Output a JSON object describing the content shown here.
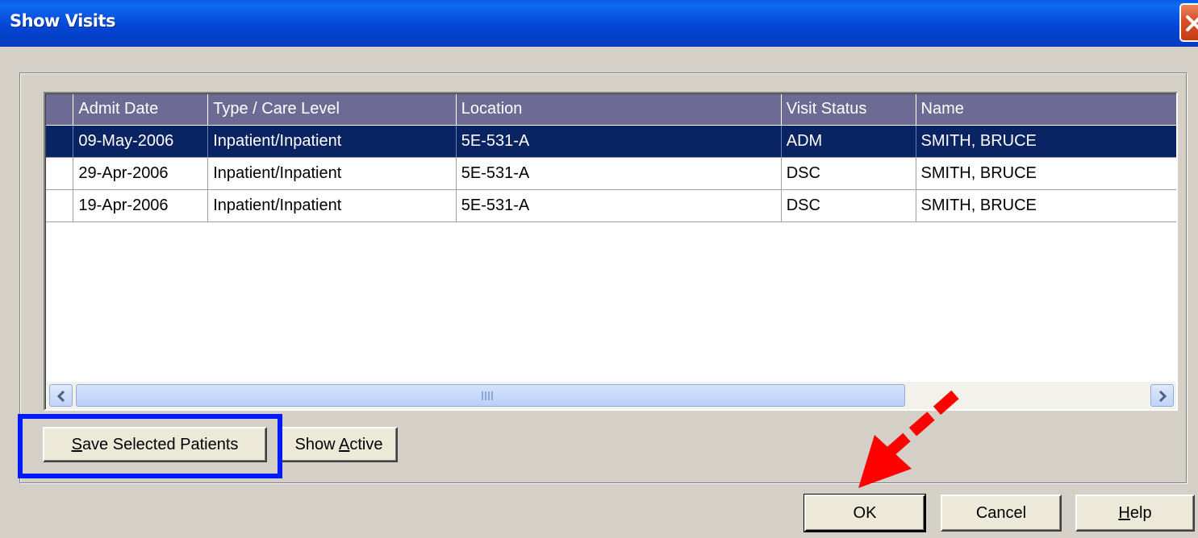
{
  "window": {
    "title": "Show Visits"
  },
  "grid": {
    "columns": [
      "Admit Date",
      "Type / Care Level",
      "Location",
      "Visit Status",
      "Name"
    ],
    "rows": [
      {
        "admit_date": "09-May-2006",
        "type": "Inpatient/Inpatient",
        "location": "5E-531-A",
        "status": "ADM",
        "name": "SMITH, BRUCE",
        "selected": true
      },
      {
        "admit_date": "29-Apr-2006",
        "type": "Inpatient/Inpatient",
        "location": "5E-531-A",
        "status": "DSC",
        "name": "SMITH, BRUCE",
        "selected": false
      },
      {
        "admit_date": "19-Apr-2006",
        "type": "Inpatient/Inpatient",
        "location": "5E-531-A",
        "status": "DSC",
        "name": "SMITH, BRUCE",
        "selected": false
      }
    ]
  },
  "buttons": {
    "save_selected_pre": "",
    "save_selected_accel": "S",
    "save_selected_post": "ave Selected Patients",
    "show_active_pre": "Show ",
    "show_active_accel": "A",
    "show_active_post": "ctive",
    "ok": "OK",
    "cancel": "Cancel",
    "help_accel": "H",
    "help_post": "elp"
  },
  "colors": {
    "title_bar": "#0646d6",
    "header_bg": "#6d6a94",
    "selected_row": "#0a2463",
    "highlight_box": "#0019ff",
    "annotation_arrow": "#ff0000"
  },
  "icons": [
    "close-icon",
    "scroll-left-icon",
    "scroll-right-icon",
    "annotation-arrow-icon"
  ]
}
